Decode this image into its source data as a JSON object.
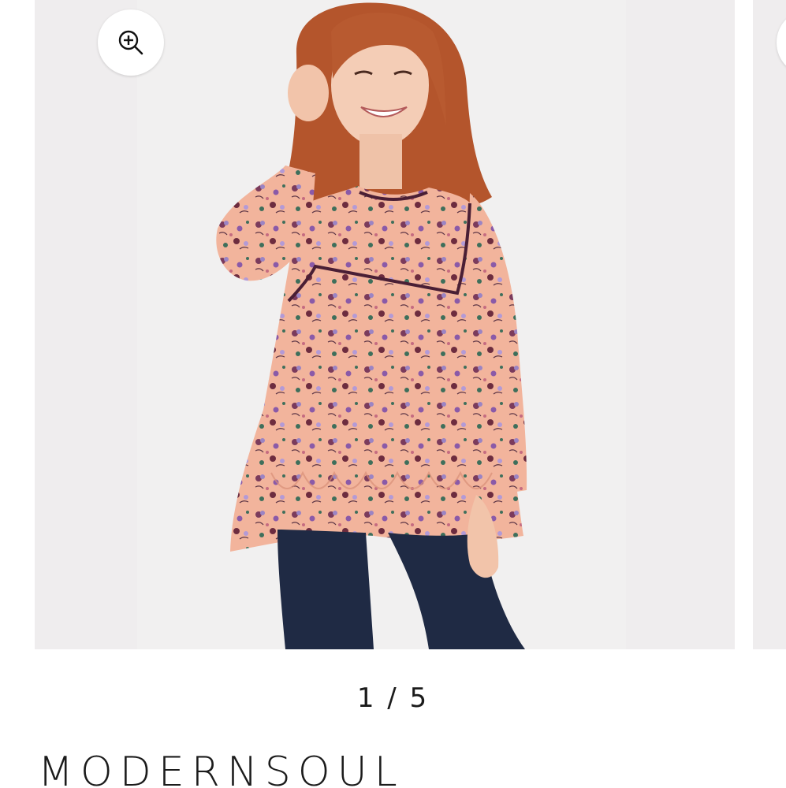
{
  "gallery": {
    "pager_current": "1",
    "pager_separator": "/",
    "pager_total": "5"
  },
  "product": {
    "brand": "MODERNSOUL"
  },
  "icons": {
    "zoom": "zoom-in-icon"
  },
  "colors": {
    "background": "#ffffff",
    "slide_background": "#efedee",
    "text": "#1b1b1b",
    "blouse": "#f2b49c",
    "piping": "#4a1f35",
    "jeans": "#1f2a44",
    "hair": "#b4552c"
  }
}
